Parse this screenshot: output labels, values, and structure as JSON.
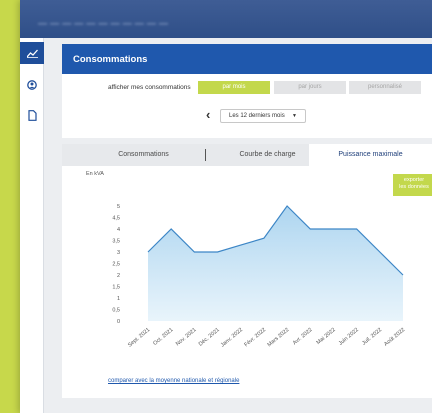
{
  "window": {
    "title": "— — — — — — — — — — —"
  },
  "sidebar": {
    "items": [
      {
        "icon": "chart-line-icon",
        "active": true
      },
      {
        "icon": "user-icon",
        "active": false
      },
      {
        "icon": "document-icon",
        "active": false
      }
    ]
  },
  "header": {
    "title": "Consommations"
  },
  "filters": {
    "label": "afficher mes consommations",
    "options": [
      "par mois",
      "par jours",
      "personnalisé"
    ],
    "selected": "par mois",
    "period": "Les 12 derniers mois"
  },
  "tabs": [
    "Consommations",
    "Courbe de charge",
    "Puissance maximale"
  ],
  "active_tab": "Puissance maximale",
  "chart": {
    "unit_label": "En kVA",
    "export_label_line1": "exporter",
    "export_label_line2": "les données",
    "link": "comparer avec la moyenne nationale et régionale"
  },
  "colors": {
    "accent": "#c3d84c",
    "primary": "#1f58ad",
    "line": "#3d86c6",
    "fill": "#a9d3ef"
  },
  "chart_data": {
    "type": "area",
    "categories": [
      "Sept. 2021",
      "Oct. 2021",
      "Nov. 2021",
      "Déc. 2021",
      "Janv. 2022",
      "Févr. 2022",
      "Mars 2022",
      "Avr. 2022",
      "Mai 2022",
      "Juin 2022",
      "Juil. 2022",
      "Août 2022"
    ],
    "series": [
      {
        "values": [
          3,
          4,
          3,
          3,
          3.3,
          3.6,
          5,
          4,
          4,
          4,
          3,
          2
        ]
      }
    ],
    "ylabel": "En kVA",
    "ylim": [
      0,
      5
    ],
    "yticks": [
      "0",
      "0,5",
      "1",
      "1,5",
      "2",
      "2,5",
      "3",
      "3,5",
      "4",
      "4,5",
      "5"
    ],
    "grid": false
  }
}
